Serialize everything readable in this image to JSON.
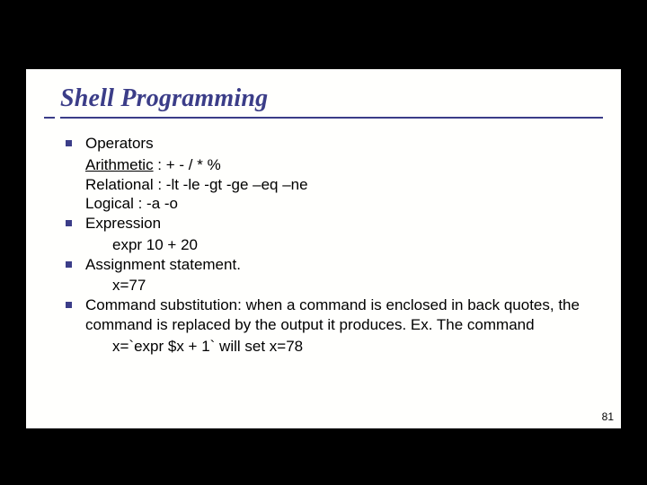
{
  "title": "Shell Programming",
  "items": [
    {
      "head": "Operators",
      "lines": [
        {
          "label": "Arithmetic",
          "underline_label": true,
          "rest": "  :  +  -  /  *  %"
        },
        {
          "label": "Relational",
          "underline_label": false,
          "rest": "   :  -lt  -le  -gt  -ge –eq –ne"
        },
        {
          "label": "Logical",
          "underline_label": false,
          "rest": "       :  -a   -o"
        }
      ]
    },
    {
      "head": "Expression",
      "example": "expr  10 + 20"
    },
    {
      "head": "Assignment statement.",
      "example": "x=77"
    },
    {
      "head": "Command substitution: when a command is enclosed in back quotes, the command is replaced by the output it produces. Ex. The command",
      "example": "x=`expr $x + 1`  will set x=78"
    }
  ],
  "page_number": "81"
}
